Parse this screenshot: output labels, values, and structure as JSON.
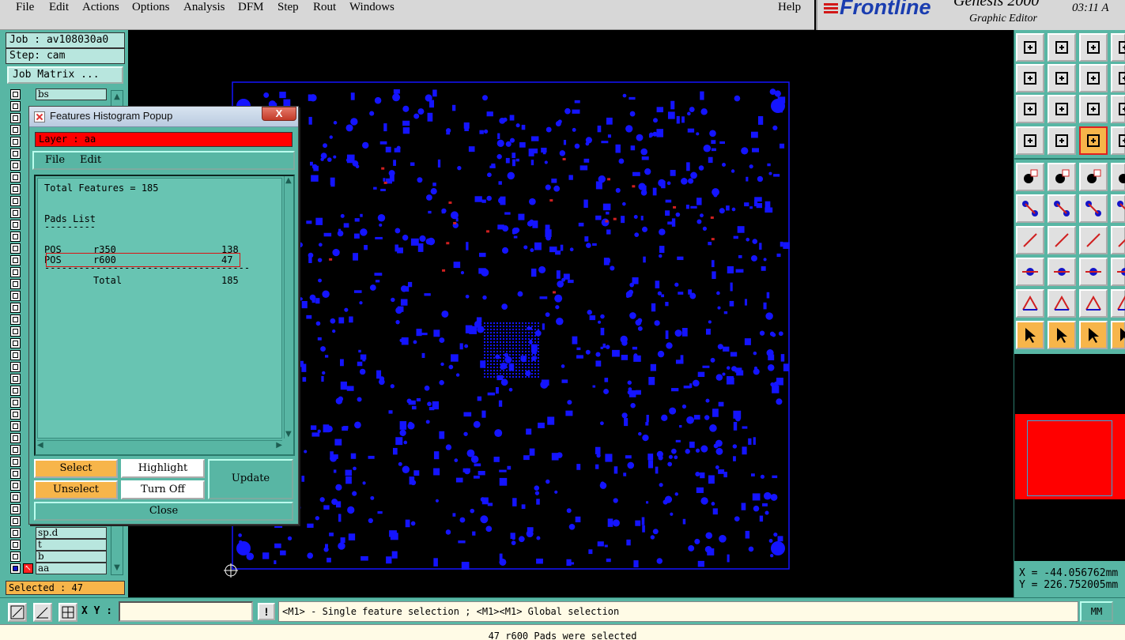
{
  "menu": {
    "items": [
      "File",
      "Edit",
      "Actions",
      "Options",
      "Analysis",
      "DFM",
      "Step",
      "Rout",
      "Windows"
    ],
    "help": "Help"
  },
  "brand": {
    "logo": "Frontline",
    "product": "Genesis 2000",
    "subtitle": "Graphic Editor",
    "clock": "03:11 A"
  },
  "left": {
    "job": "Job : av108030a0",
    "step": "Step: cam",
    "job_matrix": "Job Matrix ...",
    "layers_top": [
      "bs"
    ],
    "layers_bottom": [
      "sp.d",
      "t",
      "b",
      "aa"
    ],
    "selected": "Selected : 47"
  },
  "popup": {
    "title": "Features Histogram Popup",
    "close_glyph": "X",
    "layer": "Layer :  aa",
    "menu": {
      "file": "File",
      "edit": "Edit"
    },
    "text": {
      "total": "Total Features = 185",
      "pads_header": "Pads List",
      "underline": "---------",
      "rows": [
        {
          "a": "POS",
          "b": "r350",
          "c": "138"
        },
        {
          "a": "POS",
          "b": "r600",
          "c": "47"
        }
      ],
      "divider": "------------------------------------",
      "total_label": "Total",
      "total_value": "185"
    },
    "buttons": {
      "select": "Select",
      "unselect": "Unselect",
      "highlight": "Highlight",
      "turn_off": "Turn Off",
      "update": "Update",
      "close": "Close"
    }
  },
  "coords": {
    "x": "X = -44.056762mm",
    "y": "Y = 226.752005mm"
  },
  "bottom": {
    "xy_label": "X Y :",
    "xy_value": "",
    "bang": "!",
    "hint": "<M1> - Single feature selection ; <M1><M1> Global selection",
    "unit": "MM",
    "status": "47 r600 Pads were selected"
  },
  "colors": {
    "teal": "#58b6a4",
    "pcb_blue": "#1414ff",
    "highlight_red": "#ff0000",
    "button_orange": "#f7b54a"
  }
}
